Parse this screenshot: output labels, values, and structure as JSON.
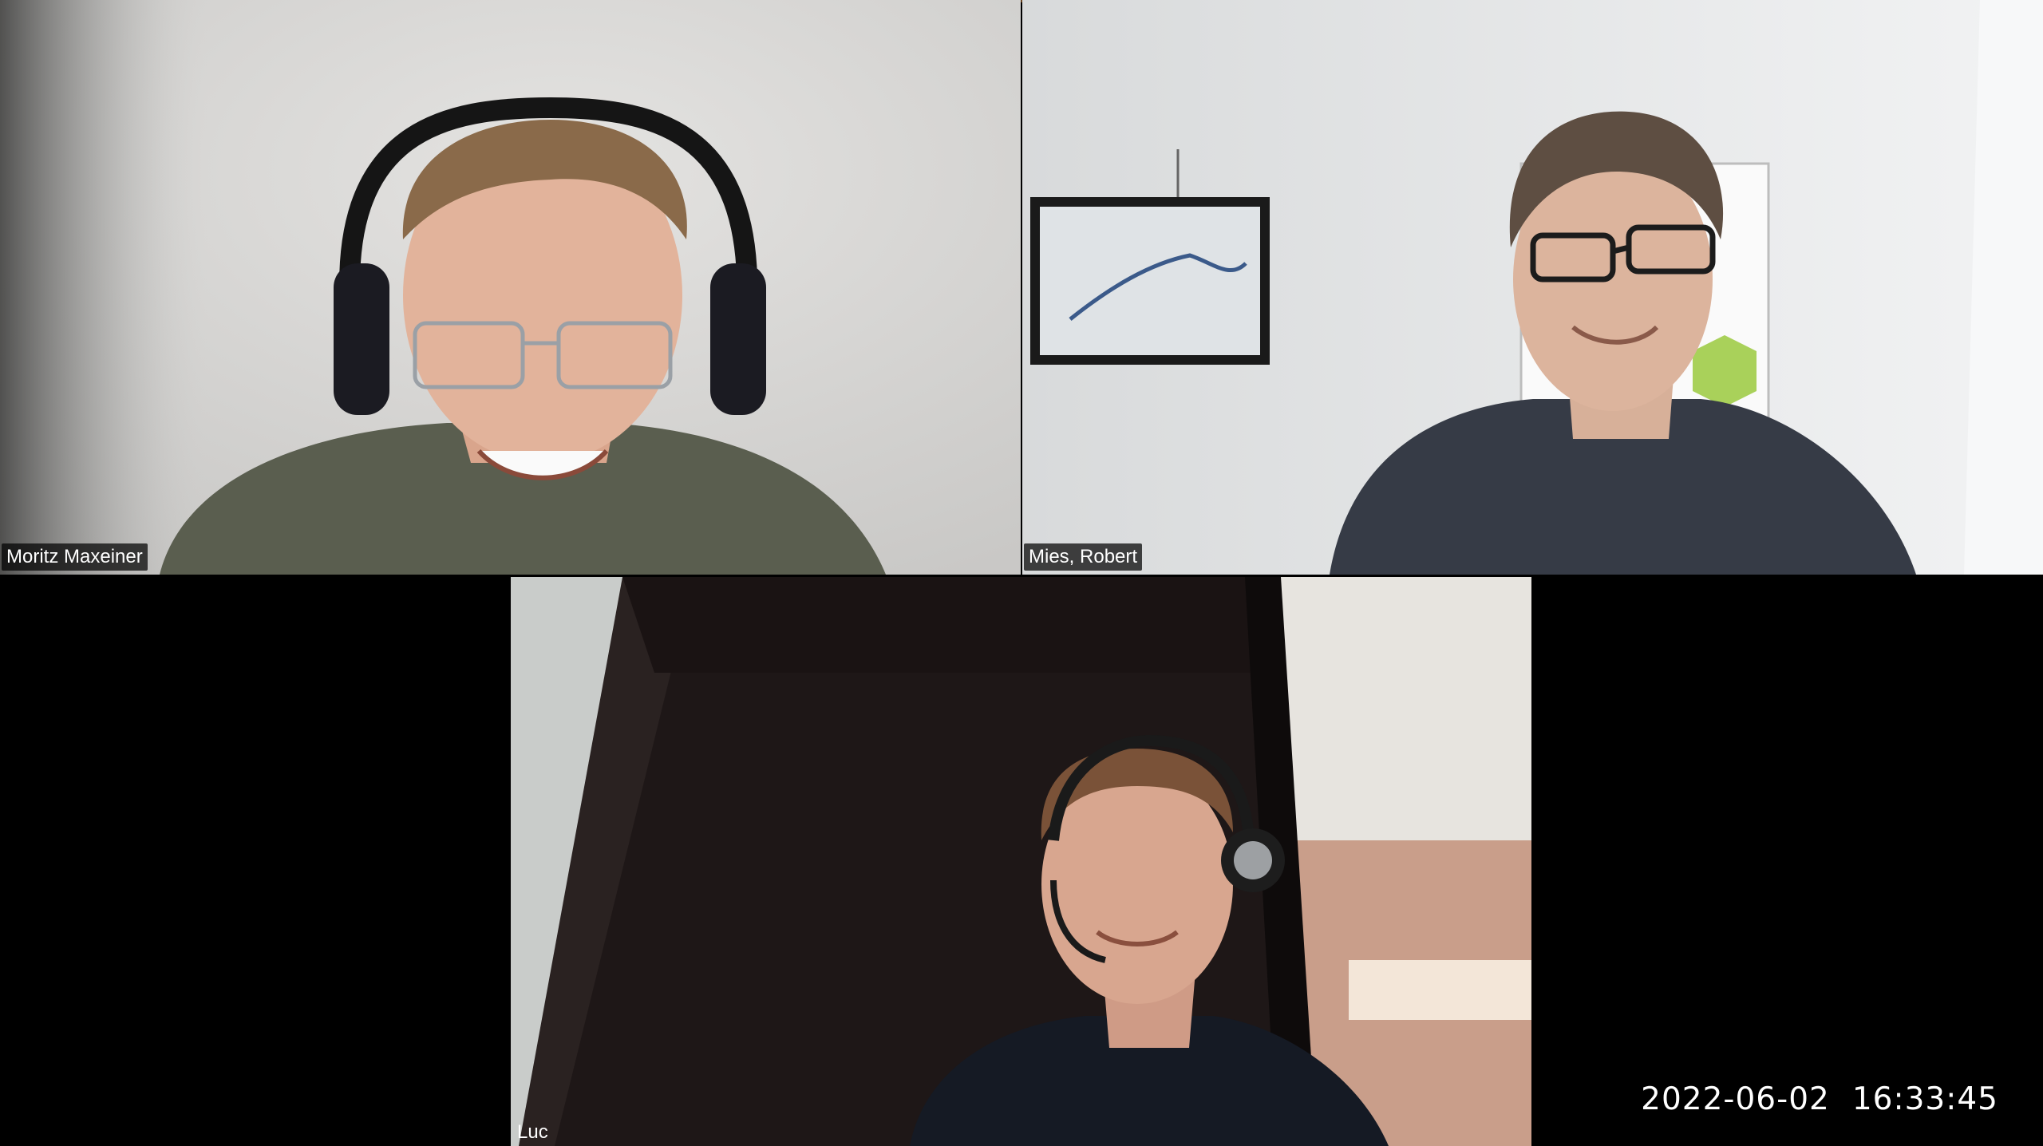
{
  "participants": [
    {
      "name": "Moritz Maxeiner"
    },
    {
      "name": "Mies, Robert"
    },
    {
      "name": "Luc"
    }
  ],
  "recording_overlay": {
    "date": "2022-06-02",
    "time": "16:33:45"
  },
  "colors": {
    "background": "#000000",
    "name_label_bg": "#000000",
    "name_label_text": "#ffffff"
  }
}
